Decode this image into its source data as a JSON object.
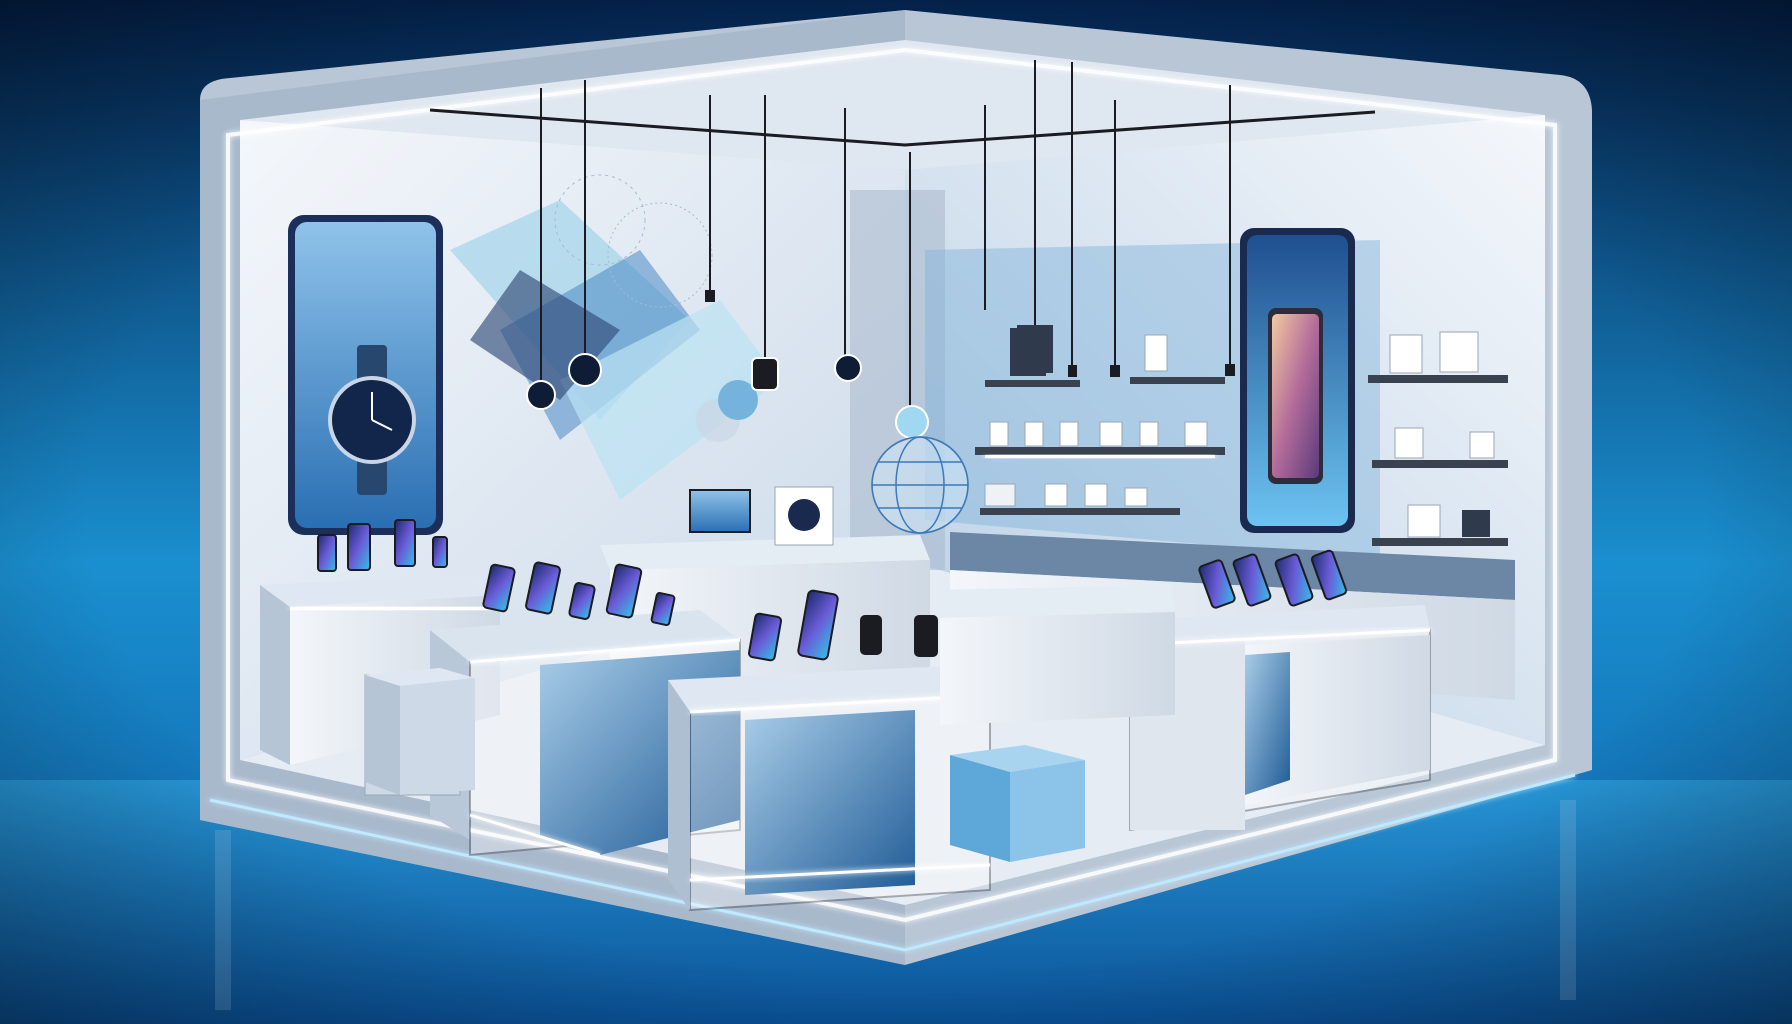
{
  "scene": {
    "subject": "showroom-cutaway",
    "colors": {
      "backdrop_top": "#04234f",
      "backdrop_mid": "#1a8fcf",
      "backdrop_bottom": "#0d5fa8",
      "wall_light": "#eef2f7",
      "wall_blue": "#5a9fd0",
      "accent_cyan": "#6fd3f5",
      "counter_white": "#e9edf2",
      "counter_blue": "#2d6fa8",
      "frame_gray": "#8a99ad",
      "led_glow": "#ffffff"
    },
    "icons": {
      "watch_poster": "wristwatch-icon",
      "phone_poster": "smartphone-icon",
      "pendant_lights": "pendant-lamp-icon"
    }
  }
}
